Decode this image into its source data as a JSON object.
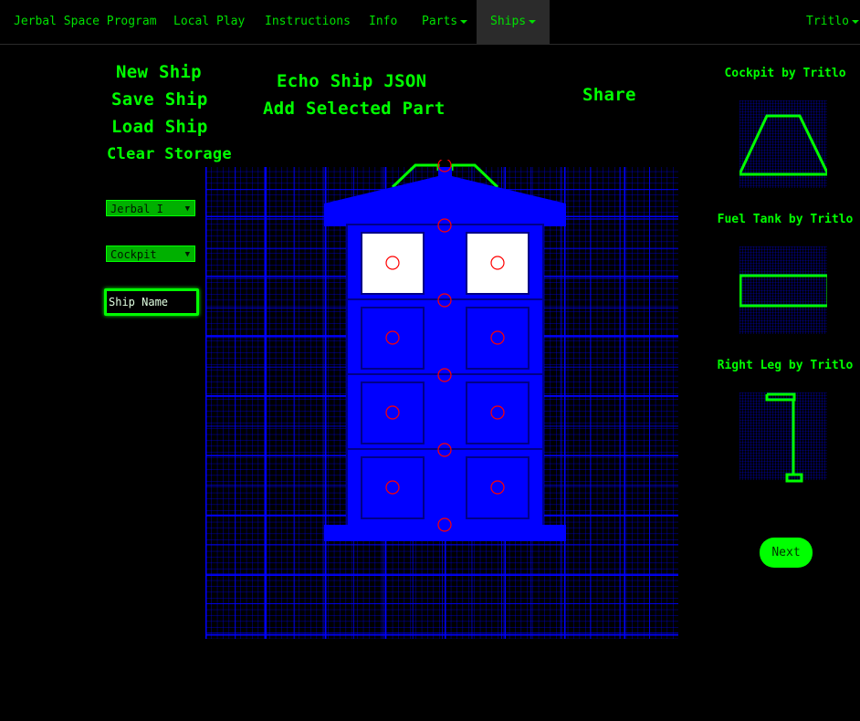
{
  "nav": {
    "brand": "Jerbal Space Program",
    "items": [
      {
        "label": "Local Play"
      },
      {
        "label": "Instructions"
      },
      {
        "label": "Info"
      },
      {
        "label": "Parts"
      },
      {
        "label": "Ships"
      }
    ],
    "user": "Tritlo"
  },
  "actions": {
    "new_ship": "New Ship",
    "save_ship": "Save Ship",
    "load_ship": "Load Ship",
    "clear_storage": "Clear Storage",
    "echo_json": "Echo Ship JSON",
    "add_part": "Add Selected Part",
    "share": "Share"
  },
  "controls": {
    "ship_select": "Jerbal I",
    "part_select": "Cockpit",
    "ship_name_placeholder": "Ship Name"
  },
  "parts_panel": {
    "items": [
      {
        "label": "Cockpit by Tritlo",
        "icon": "cockpit-shape"
      },
      {
        "label": "Fuel Tank by Tritlo",
        "icon": "fuel-tank-shape"
      },
      {
        "label": "Right Leg by Tritlo",
        "icon": "leg-shape"
      }
    ],
    "next": "Next"
  },
  "colors": {
    "accent": "#00ff00",
    "grid": "#0000ff",
    "ship": "#0000ff",
    "anchor": "#ff0000"
  }
}
